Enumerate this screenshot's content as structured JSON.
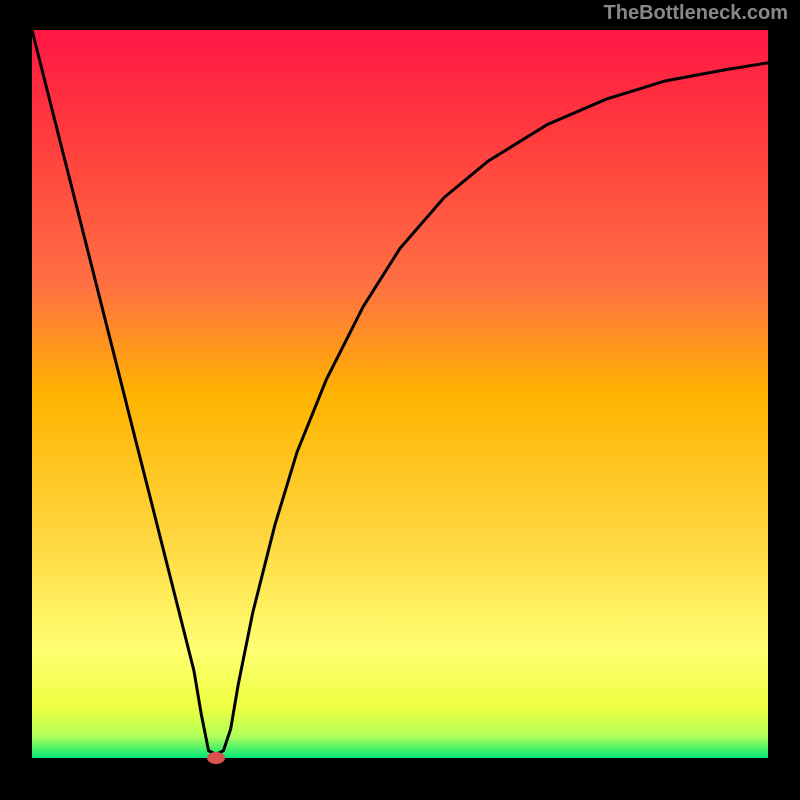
{
  "watermark_text": "TheBottleneck.com",
  "chart_data": {
    "type": "line",
    "title": "",
    "xlabel": "",
    "ylabel": "",
    "x_range": [
      0,
      100
    ],
    "y_range": [
      0,
      100
    ],
    "gradient_stops": [
      {
        "offset": 0,
        "color": "#ff1744"
      },
      {
        "offset": 0.15,
        "color": "#ff3d3d"
      },
      {
        "offset": 0.35,
        "color": "#ff7043"
      },
      {
        "offset": 0.5,
        "color": "#ffb300"
      },
      {
        "offset": 0.7,
        "color": "#ffd740"
      },
      {
        "offset": 0.85,
        "color": "#ffff72"
      },
      {
        "offset": 0.93,
        "color": "#eeff41"
      },
      {
        "offset": 0.97,
        "color": "#b2ff59"
      },
      {
        "offset": 1.0,
        "color": "#00e676"
      }
    ],
    "series": [
      {
        "name": "bottleneck-curve",
        "type": "line",
        "color": "#000000",
        "points": [
          {
            "x": 0,
            "y": 100
          },
          {
            "x": 2,
            "y": 92
          },
          {
            "x": 4,
            "y": 84
          },
          {
            "x": 6,
            "y": 76
          },
          {
            "x": 8,
            "y": 68
          },
          {
            "x": 10,
            "y": 60
          },
          {
            "x": 12,
            "y": 52
          },
          {
            "x": 14,
            "y": 44
          },
          {
            "x": 16,
            "y": 36
          },
          {
            "x": 18,
            "y": 28
          },
          {
            "x": 20,
            "y": 20
          },
          {
            "x": 22,
            "y": 12
          },
          {
            "x": 23,
            "y": 6
          },
          {
            "x": 24,
            "y": 1
          },
          {
            "x": 25,
            "y": 0.5
          },
          {
            "x": 26,
            "y": 1
          },
          {
            "x": 27,
            "y": 4
          },
          {
            "x": 28,
            "y": 10
          },
          {
            "x": 30,
            "y": 20
          },
          {
            "x": 33,
            "y": 32
          },
          {
            "x": 36,
            "y": 42
          },
          {
            "x": 40,
            "y": 52
          },
          {
            "x": 45,
            "y": 62
          },
          {
            "x": 50,
            "y": 70
          },
          {
            "x": 56,
            "y": 77
          },
          {
            "x": 62,
            "y": 82
          },
          {
            "x": 70,
            "y": 87
          },
          {
            "x": 78,
            "y": 90.5
          },
          {
            "x": 86,
            "y": 93
          },
          {
            "x": 94,
            "y": 94.5
          },
          {
            "x": 100,
            "y": 95.5
          }
        ]
      }
    ],
    "marker": {
      "x": 25,
      "y": 0,
      "color": "#d9534f"
    }
  }
}
